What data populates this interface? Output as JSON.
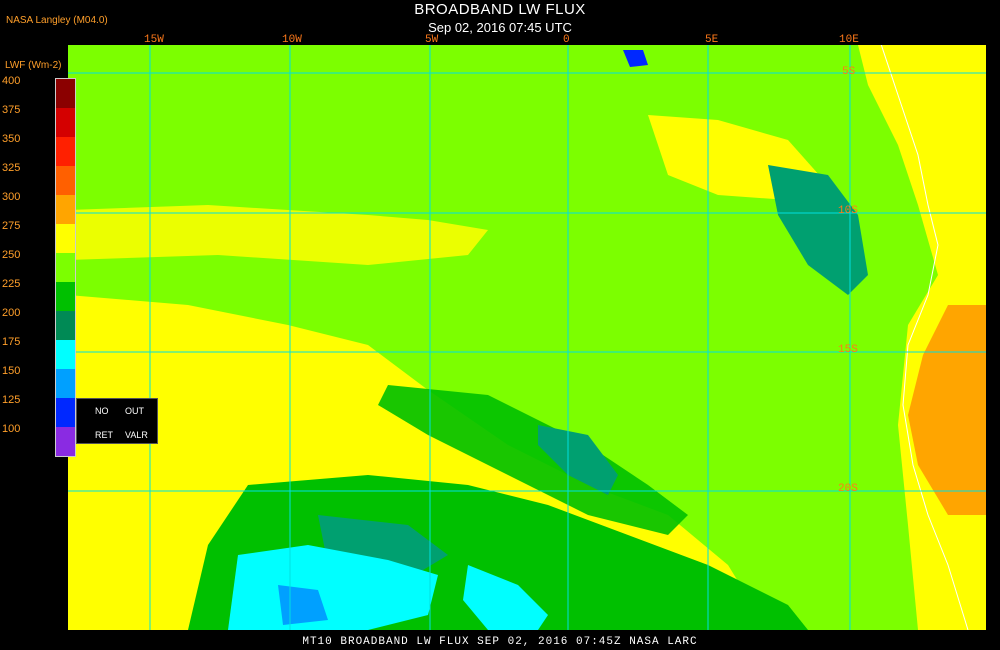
{
  "header": {
    "source": "NASA Langley (M04.0)",
    "title": "BROADBAND LW FLUX",
    "datetime": "Sep 02, 2016 07:45 UTC"
  },
  "map": {
    "lon_labels": [
      "15W",
      "10W",
      "5W",
      "0",
      "5E",
      "10E"
    ],
    "lat_labels": [
      "5S",
      "10S",
      "15S",
      "20S"
    ],
    "colors": {
      "ocean_green": "#7cff00",
      "yellow": "#ffff00",
      "dark_green": "#00c000",
      "teal": "#00a070",
      "cyan": "#00ffff",
      "blue": "#00a0ff",
      "orange": "#ffa500",
      "grid": "#00e0e0"
    }
  },
  "legend": {
    "title": "LWF (Wm-2)",
    "ticks": [
      "400",
      "375",
      "350",
      "325",
      "300",
      "275",
      "250",
      "225",
      "200",
      "175",
      "150",
      "125",
      "100"
    ],
    "swatches": [
      "#8b0000",
      "#d40000",
      "#ff2000",
      "#ff6000",
      "#ffa500",
      "#ffff00",
      "#7cff00",
      "#00c000",
      "#008a55",
      "#00ffff",
      "#00a0ff",
      "#0028ff",
      "#8a2be2"
    ],
    "flags": {
      "no": "NO",
      "ret": "RET",
      "out": "OUT",
      "valr": "VALR"
    }
  },
  "footer": {
    "text": "MT10  BROADBAND LW FLUX   SEP 02, 2016 07:45Z   NASA LARC"
  }
}
